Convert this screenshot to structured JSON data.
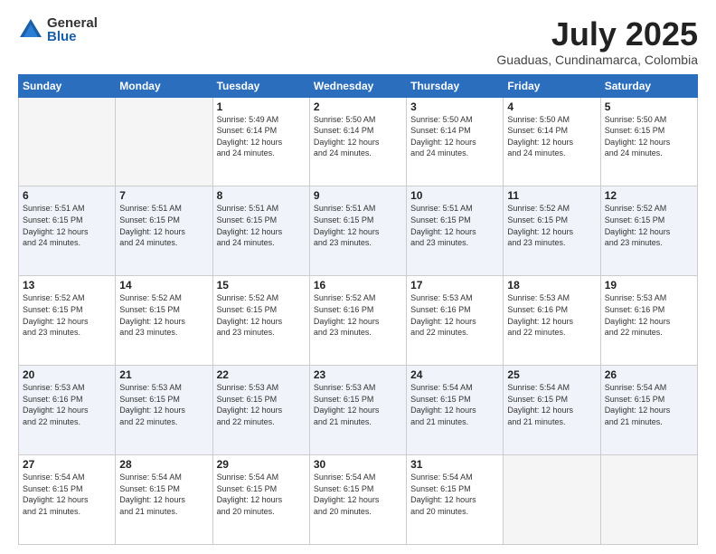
{
  "logo": {
    "general": "General",
    "blue": "Blue"
  },
  "title": "July 2025",
  "subtitle": "Guaduas, Cundinamarca, Colombia",
  "weekdays": [
    "Sunday",
    "Monday",
    "Tuesday",
    "Wednesday",
    "Thursday",
    "Friday",
    "Saturday"
  ],
  "weeks": [
    [
      {
        "day": "",
        "info": ""
      },
      {
        "day": "",
        "info": ""
      },
      {
        "day": "1",
        "info": "Sunrise: 5:49 AM\nSunset: 6:14 PM\nDaylight: 12 hours\nand 24 minutes."
      },
      {
        "day": "2",
        "info": "Sunrise: 5:50 AM\nSunset: 6:14 PM\nDaylight: 12 hours\nand 24 minutes."
      },
      {
        "day": "3",
        "info": "Sunrise: 5:50 AM\nSunset: 6:14 PM\nDaylight: 12 hours\nand 24 minutes."
      },
      {
        "day": "4",
        "info": "Sunrise: 5:50 AM\nSunset: 6:14 PM\nDaylight: 12 hours\nand 24 minutes."
      },
      {
        "day": "5",
        "info": "Sunrise: 5:50 AM\nSunset: 6:15 PM\nDaylight: 12 hours\nand 24 minutes."
      }
    ],
    [
      {
        "day": "6",
        "info": "Sunrise: 5:51 AM\nSunset: 6:15 PM\nDaylight: 12 hours\nand 24 minutes."
      },
      {
        "day": "7",
        "info": "Sunrise: 5:51 AM\nSunset: 6:15 PM\nDaylight: 12 hours\nand 24 minutes."
      },
      {
        "day": "8",
        "info": "Sunrise: 5:51 AM\nSunset: 6:15 PM\nDaylight: 12 hours\nand 24 minutes."
      },
      {
        "day": "9",
        "info": "Sunrise: 5:51 AM\nSunset: 6:15 PM\nDaylight: 12 hours\nand 23 minutes."
      },
      {
        "day": "10",
        "info": "Sunrise: 5:51 AM\nSunset: 6:15 PM\nDaylight: 12 hours\nand 23 minutes."
      },
      {
        "day": "11",
        "info": "Sunrise: 5:52 AM\nSunset: 6:15 PM\nDaylight: 12 hours\nand 23 minutes."
      },
      {
        "day": "12",
        "info": "Sunrise: 5:52 AM\nSunset: 6:15 PM\nDaylight: 12 hours\nand 23 minutes."
      }
    ],
    [
      {
        "day": "13",
        "info": "Sunrise: 5:52 AM\nSunset: 6:15 PM\nDaylight: 12 hours\nand 23 minutes."
      },
      {
        "day": "14",
        "info": "Sunrise: 5:52 AM\nSunset: 6:15 PM\nDaylight: 12 hours\nand 23 minutes."
      },
      {
        "day": "15",
        "info": "Sunrise: 5:52 AM\nSunset: 6:15 PM\nDaylight: 12 hours\nand 23 minutes."
      },
      {
        "day": "16",
        "info": "Sunrise: 5:52 AM\nSunset: 6:16 PM\nDaylight: 12 hours\nand 23 minutes."
      },
      {
        "day": "17",
        "info": "Sunrise: 5:53 AM\nSunset: 6:16 PM\nDaylight: 12 hours\nand 22 minutes."
      },
      {
        "day": "18",
        "info": "Sunrise: 5:53 AM\nSunset: 6:16 PM\nDaylight: 12 hours\nand 22 minutes."
      },
      {
        "day": "19",
        "info": "Sunrise: 5:53 AM\nSunset: 6:16 PM\nDaylight: 12 hours\nand 22 minutes."
      }
    ],
    [
      {
        "day": "20",
        "info": "Sunrise: 5:53 AM\nSunset: 6:16 PM\nDaylight: 12 hours\nand 22 minutes."
      },
      {
        "day": "21",
        "info": "Sunrise: 5:53 AM\nSunset: 6:15 PM\nDaylight: 12 hours\nand 22 minutes."
      },
      {
        "day": "22",
        "info": "Sunrise: 5:53 AM\nSunset: 6:15 PM\nDaylight: 12 hours\nand 22 minutes."
      },
      {
        "day": "23",
        "info": "Sunrise: 5:53 AM\nSunset: 6:15 PM\nDaylight: 12 hours\nand 21 minutes."
      },
      {
        "day": "24",
        "info": "Sunrise: 5:54 AM\nSunset: 6:15 PM\nDaylight: 12 hours\nand 21 minutes."
      },
      {
        "day": "25",
        "info": "Sunrise: 5:54 AM\nSunset: 6:15 PM\nDaylight: 12 hours\nand 21 minutes."
      },
      {
        "day": "26",
        "info": "Sunrise: 5:54 AM\nSunset: 6:15 PM\nDaylight: 12 hours\nand 21 minutes."
      }
    ],
    [
      {
        "day": "27",
        "info": "Sunrise: 5:54 AM\nSunset: 6:15 PM\nDaylight: 12 hours\nand 21 minutes."
      },
      {
        "day": "28",
        "info": "Sunrise: 5:54 AM\nSunset: 6:15 PM\nDaylight: 12 hours\nand 21 minutes."
      },
      {
        "day": "29",
        "info": "Sunrise: 5:54 AM\nSunset: 6:15 PM\nDaylight: 12 hours\nand 20 minutes."
      },
      {
        "day": "30",
        "info": "Sunrise: 5:54 AM\nSunset: 6:15 PM\nDaylight: 12 hours\nand 20 minutes."
      },
      {
        "day": "31",
        "info": "Sunrise: 5:54 AM\nSunset: 6:15 PM\nDaylight: 12 hours\nand 20 minutes."
      },
      {
        "day": "",
        "info": ""
      },
      {
        "day": "",
        "info": ""
      }
    ]
  ]
}
